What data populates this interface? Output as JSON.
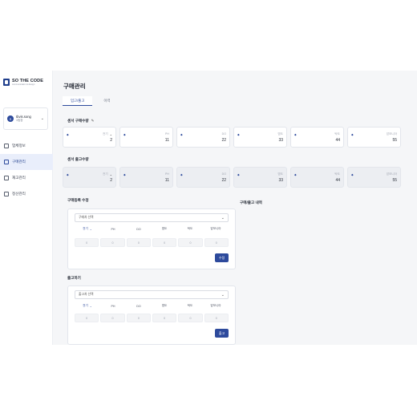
{
  "brand": {
    "title": "SO THE CODE",
    "subtitle": "communication & design"
  },
  "user": {
    "initial": "S",
    "name": "Ibvis.song",
    "role": "1팀장"
  },
  "nav": [
    {
      "label": "업체정보"
    },
    {
      "label": "구매관리"
    },
    {
      "label": "재고관리"
    },
    {
      "label": "정산관리"
    }
  ],
  "page": {
    "title": "구매관리"
  },
  "tabs": [
    {
      "label": "입고/출고"
    },
    {
      "label": "이력"
    }
  ],
  "stock": {
    "title": "센서 구매수량",
    "cells": [
      {
        "label": "전기",
        "value": "2"
      },
      {
        "label": "PH",
        "value": "11"
      },
      {
        "label": "DO",
        "value": "22"
      },
      {
        "label": "염도",
        "value": "33"
      },
      {
        "label": "탁도",
        "value": "44"
      },
      {
        "label": "암모니아",
        "value": "55"
      }
    ]
  },
  "shipment": {
    "title": "센서 출고수량",
    "cells": [
      {
        "label": "전기",
        "value": "2"
      },
      {
        "label": "PH",
        "value": "11"
      },
      {
        "label": "DO",
        "value": "22"
      },
      {
        "label": "염도",
        "value": "33"
      },
      {
        "label": "탁도",
        "value": "44"
      },
      {
        "label": "암모니아",
        "value": "55"
      }
    ]
  },
  "purchase": {
    "title": "구매등록 수정",
    "select": "구매처 선택",
    "headers": [
      "전기",
      "PH",
      "DO",
      "염도",
      "탁도",
      "암모니아"
    ],
    "inputs": [
      "0",
      "0",
      "0",
      "0",
      "0",
      "0"
    ],
    "button": "수정"
  },
  "history": {
    "title": "구매/출고 내역"
  },
  "release": {
    "title": "출고하기",
    "select": "출고처 선택",
    "headers": [
      "전기",
      "PH",
      "DO",
      "염도",
      "탁도",
      "암모니아"
    ],
    "inputs": [
      "0",
      "0",
      "0",
      "0",
      "0",
      "0"
    ],
    "button": "출고"
  },
  "colors": {
    "accent": "#2d4a9c",
    "background": "#f5f6f8"
  }
}
